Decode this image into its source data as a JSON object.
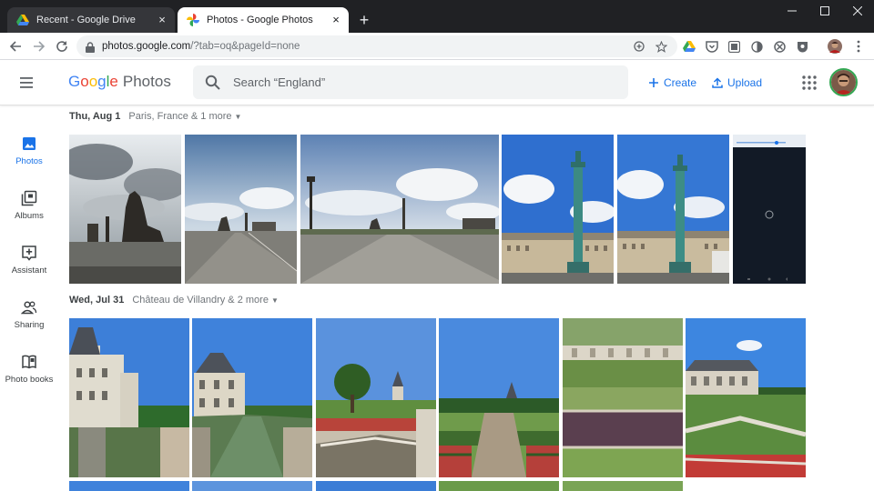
{
  "browser": {
    "tabs": [
      {
        "title": "Recent - Google Drive",
        "close": "×"
      },
      {
        "title": "Photos - Google Photos",
        "close": "×"
      }
    ],
    "new_tab": "+",
    "url_host": "photos.google.com",
    "url_path": "/?tab=oq&pageId=none"
  },
  "app": {
    "logo_letters": [
      "G",
      "o",
      "o",
      "g",
      "l",
      "e"
    ],
    "logo_colors": [
      "#4285f4",
      "#ea4335",
      "#fbbc05",
      "#4285f4",
      "#34a853",
      "#ea4335"
    ],
    "logo_product": "Photos",
    "search_placeholder": "Search “England”",
    "create_label": "Create",
    "upload_label": "Upload",
    "accent": "#1a73e8"
  },
  "nav": {
    "items": [
      {
        "label": "Photos",
        "icon": "photo-icon",
        "active": true
      },
      {
        "label": "Albums",
        "icon": "albums-icon",
        "active": false
      },
      {
        "label": "Assistant",
        "icon": "assistant-icon",
        "active": false
      },
      {
        "label": "Sharing",
        "icon": "sharing-icon",
        "active": false
      },
      {
        "label": "Photo books",
        "icon": "photo-books-icon",
        "active": false
      }
    ]
  },
  "sections": [
    {
      "date": "Thu, Aug 1",
      "location": "Paris, France & 1 more",
      "photos": [
        "place-de-la-concorde-statue",
        "place-de-la-concorde-wide",
        "place-de-la-concorde-panorama",
        "place-vendome-column",
        "place-vendome-column-2",
        "phone-screenshot"
      ]
    },
    {
      "date": "Wed, Jul 31",
      "location": "Château de Villandry & 2 more",
      "photos": [
        "chateau-facade",
        "chateau-moat",
        "garden-tree",
        "garden-parterre",
        "vegetable-garden",
        "garden-hedges"
      ]
    }
  ]
}
